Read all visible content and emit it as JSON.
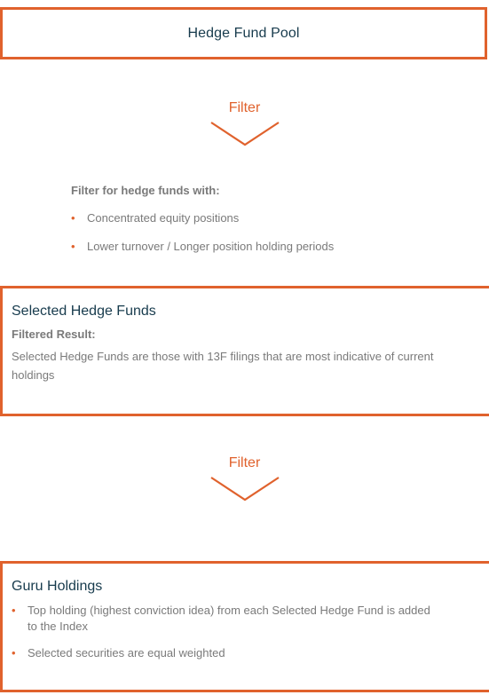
{
  "pool": {
    "title": "Hedge Fund Pool"
  },
  "filter1": {
    "label": "Filter"
  },
  "criteria": {
    "heading": "Filter for hedge funds with:",
    "items": [
      "Concentrated equity positions",
      "Lower turnover / Longer position holding periods"
    ]
  },
  "selected": {
    "title": "Selected Hedge Funds",
    "subheading": "Filtered Result:",
    "description": "Selected Hedge Funds are those with 13F filings that are most indicative of current holdings"
  },
  "filter2": {
    "label": "Filter"
  },
  "guru": {
    "title": "Guru Holdings",
    "items": [
      "Top holding (highest conviction idea) from each Selected Hedge Fund is added to the Index",
      "Selected securities are equal weighted"
    ]
  },
  "colors": {
    "accent": "#e0622d",
    "title": "#173b4d",
    "text": "#7a7a7a"
  }
}
